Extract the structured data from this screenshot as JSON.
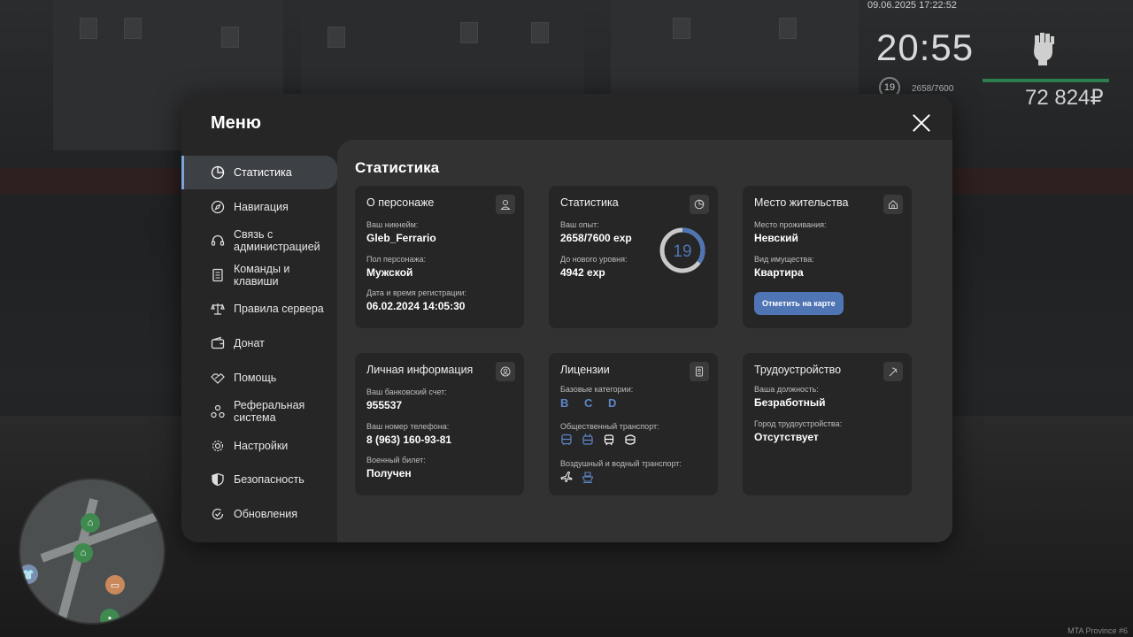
{
  "hud": {
    "datetime": "09.06.2025 17:22:52",
    "time": "20:55",
    "level": "19",
    "exp": "2658/7600",
    "money": "72 824₽",
    "watermark": "MTA Province #6"
  },
  "menu": {
    "title": "Меню",
    "sidebar": [
      {
        "label": "Статистика",
        "icon": "pie-chart-icon",
        "active": true
      },
      {
        "label": "Навигация",
        "icon": "compass-icon"
      },
      {
        "label": "Связь с администрацией",
        "icon": "headset-icon"
      },
      {
        "label": "Команды и клавиши",
        "icon": "document-icon"
      },
      {
        "label": "Правила сервера",
        "icon": "scales-icon"
      },
      {
        "label": "Донат",
        "icon": "wallet-icon"
      },
      {
        "label": "Помощь",
        "icon": "handshake-icon"
      },
      {
        "label": "Реферальная система",
        "icon": "referral-icon"
      },
      {
        "label": "Настройки",
        "icon": "gear-icon"
      },
      {
        "label": "Безопасность",
        "icon": "shield-icon"
      },
      {
        "label": "Обновления",
        "icon": "update-icon"
      }
    ],
    "content_title": "Статистика",
    "cards": {
      "character": {
        "title": "О персонаже",
        "nickname_label": "Ваш никнейм:",
        "nickname": "Gleb_Ferrario",
        "gender_label": "Пол персонажа:",
        "gender": "Мужской",
        "reg_label": "Дата и время регистрации:",
        "reg": "06.02.2024 14:05:30"
      },
      "stats": {
        "title": "Статистика",
        "exp_label": "Ваш опыт:",
        "exp": "2658/7600 exp",
        "next_label": "До нового уровня:",
        "next": "4942 exp",
        "level": "19",
        "progress": 0.35
      },
      "residence": {
        "title": "Место жительства",
        "place_label": "Место проживания:",
        "place": "Невский",
        "property_label": "Вид имущества:",
        "property": "Квартира",
        "button": "Отметить на карте"
      },
      "personal": {
        "title": "Личная информация",
        "bank_label": "Ваш банковский счет:",
        "bank": "955537",
        "phone_label": "Ваш номер телефона:",
        "phone": "8 (963) 160-93-81",
        "military_label": "Военный билет:",
        "military": "Получен"
      },
      "licenses": {
        "title": "Лицензии",
        "basic_label": "Базовые категории:",
        "basic": "B C D",
        "public_label": "Общественный транспорт:",
        "air_label": "Воздушный и водный транспорт:"
      },
      "employment": {
        "title": "Трудоустройство",
        "position_label": "Ваша должность:",
        "position": "Безработный",
        "city_label": "Город трудоустройства:",
        "city": "Отсутствует"
      }
    }
  },
  "colors": {
    "accent": "#5d86c8",
    "button": "#4f75b4",
    "health": "#2e7d4f"
  }
}
